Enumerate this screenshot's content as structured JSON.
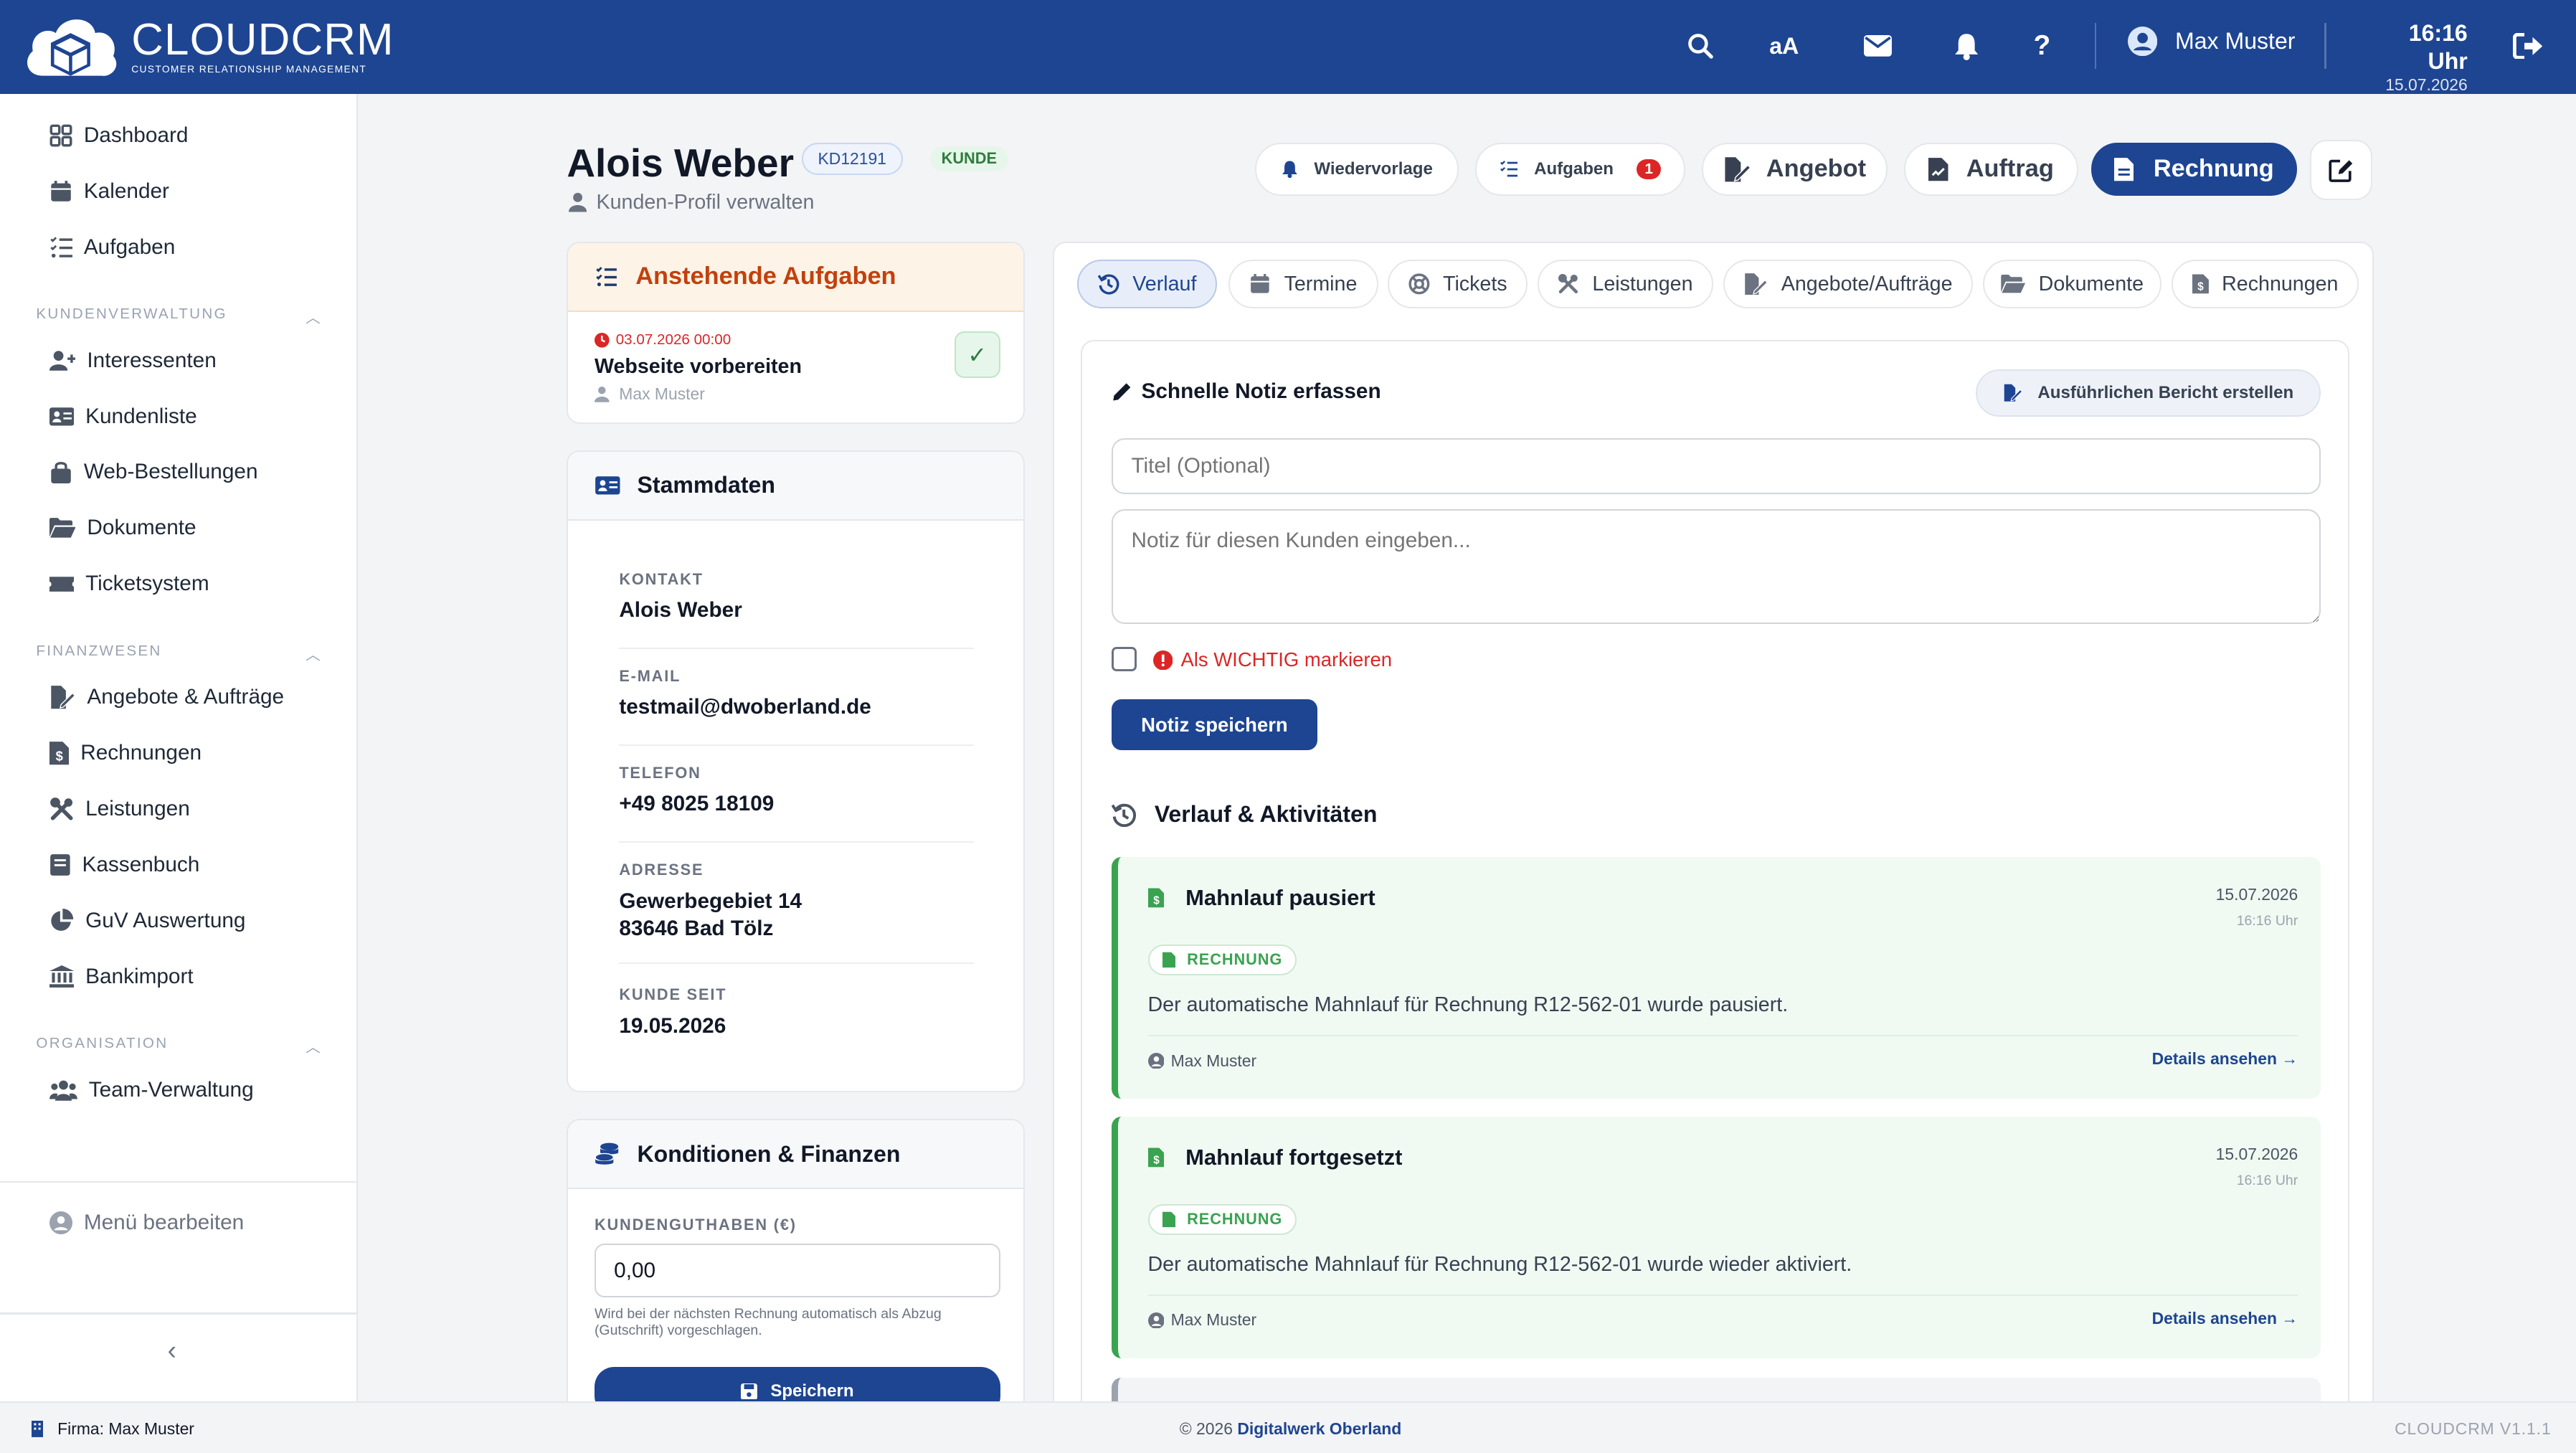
{
  "brand": {
    "name": "CLOUDCRM",
    "tagline": "CUSTOMER RELATIONSHIP MANAGEMENT"
  },
  "topbar": {
    "font_toggle": "aA",
    "user": "Max Muster",
    "time": "16:16 Uhr",
    "date": "15.07.2026"
  },
  "sidebar": {
    "top": [
      "Dashboard",
      "Kalender",
      "Aufgaben"
    ],
    "sections": [
      {
        "title": "KUNDENVERWALTUNG",
        "items": [
          "Interessenten",
          "Kundenliste",
          "Web-Bestellungen",
          "Dokumente",
          "Ticketsystem"
        ]
      },
      {
        "title": "FINANZWESEN",
        "items": [
          "Angebote & Aufträge",
          "Rechnungen",
          "Leistungen",
          "Kassenbuch",
          "GuV Auswertung",
          "Bankimport"
        ]
      },
      {
        "title": "ORGANISATION",
        "items": [
          "Team-Verwaltung"
        ]
      }
    ],
    "edit_menu": "Menü bearbeiten"
  },
  "customer": {
    "name": "Alois Weber",
    "id": "KD12191",
    "status": "KUNDE",
    "subtitle": "Kunden-Profil verwalten"
  },
  "actions": {
    "wiedervorlage": "Wiedervorlage",
    "aufgaben": "Aufgaben",
    "aufgaben_count": "1",
    "angebot": "Angebot",
    "auftrag": "Auftrag",
    "rechnung": "Rechnung"
  },
  "tasks": {
    "title": "Anstehende Aufgaben",
    "items": [
      {
        "due": "03.07.2026 00:00",
        "title": "Webseite vorbereiten",
        "owner": "Max Muster"
      }
    ]
  },
  "master": {
    "title": "Stammdaten",
    "fields": [
      {
        "label": "KONTAKT",
        "value": "Alois Weber"
      },
      {
        "label": "E-MAIL",
        "value": "testmail@dwoberland.de"
      },
      {
        "label": "TELEFON",
        "value": "+49 8025 18109"
      },
      {
        "label": "ADRESSE",
        "value": "Gewerbegebiet 14",
        "value2": "83646 Bad Tölz"
      },
      {
        "label": "KUNDE SEIT",
        "value": "19.05.2026"
      }
    ]
  },
  "finance": {
    "title": "Konditionen & Finanzen",
    "credit_label": "KUNDENGUTHABEN (€)",
    "credit_value": "0,00",
    "hint": "Wird bei der nächsten Rechnung automatisch als Abzug (Gutschrift) vorgeschlagen.",
    "save": "Speichern"
  },
  "tabs": [
    "Verlauf",
    "Termine",
    "Tickets",
    "Leistungen",
    "Angebote/Aufträge",
    "Dokumente",
    "Rechnungen"
  ],
  "note": {
    "title": "Schnelle Notiz erfassen",
    "report_button": "Ausführlichen Bericht erstellen",
    "title_placeholder": "Titel (Optional)",
    "body_placeholder": "Notiz für diesen Kunden eingeben...",
    "important": "Als WICHTIG markieren",
    "save": "Notiz speichern"
  },
  "history": {
    "title": "Verlauf & Aktivitäten",
    "items": [
      {
        "title": "Mahnlauf pausiert",
        "date": "15.07.2026",
        "time": "16:16 Uhr",
        "tag": "RECHNUNG",
        "text": "Der automatische Mahnlauf für Rechnung R12-562-01 wurde pausiert.",
        "user": "Max Muster",
        "link": "Details ansehen"
      },
      {
        "title": "Mahnlauf fortgesetzt",
        "date": "15.07.2026",
        "time": "16:16 Uhr",
        "tag": "RECHNUNG",
        "text": "Der automatische Mahnlauf für Rechnung R12-562-01 wurde wieder aktiviert.",
        "user": "Max Muster",
        "link": "Details ansehen"
      }
    ]
  },
  "footer": {
    "company": "Firma: Max Muster",
    "copyright": "© 2026",
    "company_link": "Digitalwerk Oberland",
    "version": "CLOUDCRM V1.1.1"
  },
  "colors": {
    "primary": "#1e4592",
    "danger": "#dc2626",
    "success": "#3aa350",
    "task_header": "#fdf3e7"
  }
}
